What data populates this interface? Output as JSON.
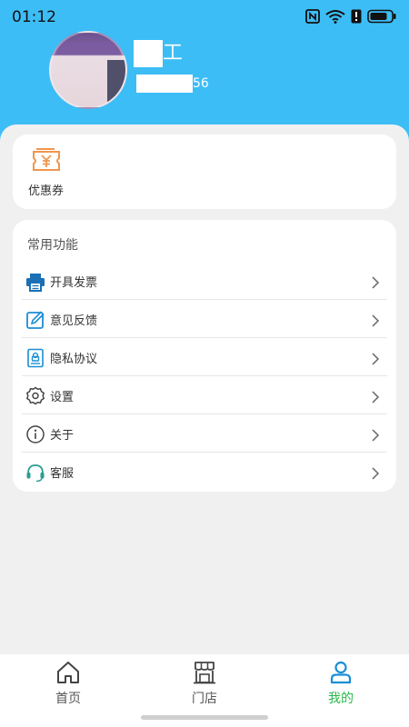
{
  "status_bar": {
    "time": "01:12"
  },
  "profile": {
    "name": "工",
    "phone": "56"
  },
  "coupon": {
    "label": "优惠券",
    "icon": "coupon-icon"
  },
  "functions": {
    "title": "常用功能",
    "items": [
      {
        "label": "开具发票",
        "icon": "printer-icon"
      },
      {
        "label": "意见反馈",
        "icon": "edit-icon"
      },
      {
        "label": "隐私协议",
        "icon": "privacy-document-icon"
      },
      {
        "label": "设置",
        "icon": "gear-icon"
      },
      {
        "label": "关于",
        "icon": "info-icon"
      },
      {
        "label": "客服",
        "icon": "headset-icon"
      }
    ]
  },
  "tabbar": {
    "tabs": [
      {
        "label": "首页",
        "icon": "home-icon",
        "active": false
      },
      {
        "label": "门店",
        "icon": "store-icon",
        "active": false
      },
      {
        "label": "我的",
        "icon": "user-icon",
        "active": true
      }
    ]
  },
  "colors": {
    "header": "#3dbdf6",
    "accent_green": "#2db84d",
    "accent_blue": "#1a8ed6",
    "coupon_orange": "#f0964f"
  }
}
